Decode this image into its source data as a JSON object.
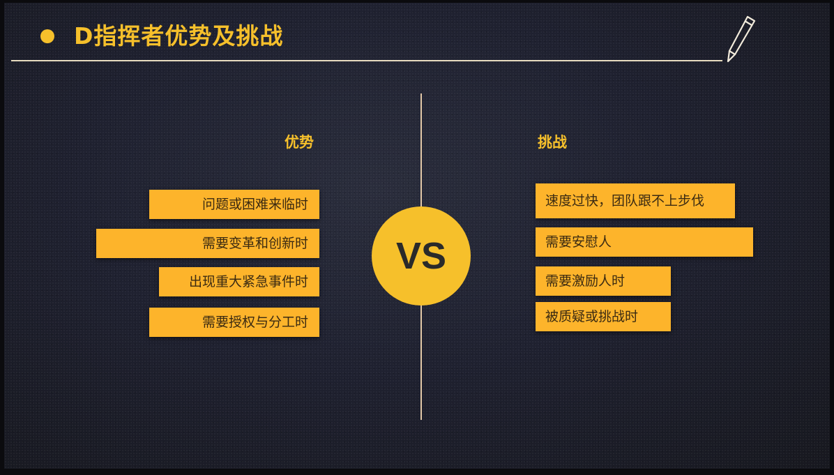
{
  "slide": {
    "title": "D指挥者优势及挑战",
    "accent_color": "#f6c02b",
    "box_color": "#fdb42b"
  },
  "left": {
    "heading": "优势",
    "items": [
      "问题或困难来临时",
      "需要变革和创新时",
      "出现重大紧急事件时",
      "需要授权与分工时"
    ]
  },
  "center": {
    "label": "VS"
  },
  "right": {
    "heading": "挑战",
    "items": [
      "速度过快，团队跟不上步伐",
      "需要安慰人",
      "需要激励人时",
      "被质疑或挑战时"
    ]
  },
  "icons": {
    "title_bullet": "bullet-dot-icon",
    "corner": "pencil-icon"
  }
}
